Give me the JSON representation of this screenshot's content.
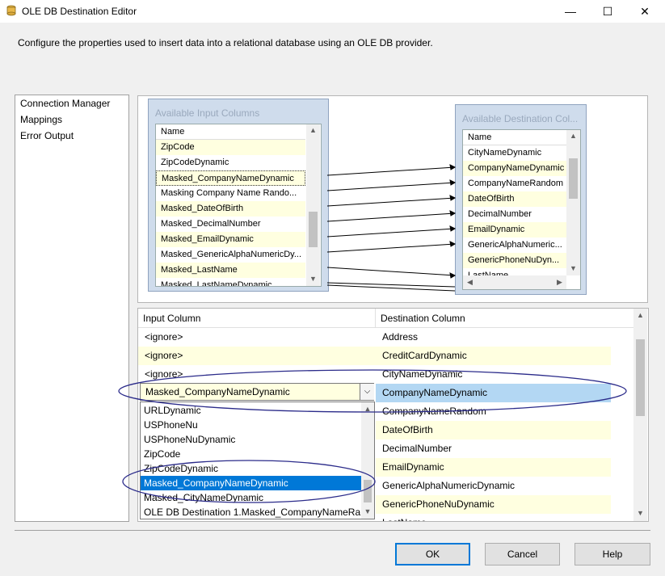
{
  "window": {
    "title": "OLE DB Destination Editor",
    "minimize_glyph": "—",
    "maximize_glyph": "☐",
    "close_glyph": "✕"
  },
  "description": "Configure the properties used to insert data into a relational database using an OLE DB provider.",
  "nav": {
    "items": [
      "Connection Manager",
      "Mappings",
      "Error Output"
    ]
  },
  "available_input": {
    "title": "Available Input Columns",
    "header": "Name",
    "rows": [
      "ZipCode",
      "ZipCodeDynamic",
      "Masked_CompanyNameDynamic",
      "Masking Company Name Rando...",
      "Masked_DateOfBirth",
      "Masked_DecimalNumber",
      "Masked_EmailDynamic",
      "Masked_GenericAlphaNumericDy...",
      "Masked_LastName",
      "Masked_LastNameDynamic"
    ]
  },
  "available_destination": {
    "title": "Available Destination Col...",
    "header": "Name",
    "rows": [
      "CityNameDynamic",
      "CompanyNameDynamic",
      "CompanyNameRandom",
      "DateOfBirth",
      "DecimalNumber",
      "EmailDynamic",
      "GenericAlphaNumeric...",
      "GenericPhoneNuDyn...",
      "LastName"
    ]
  },
  "grid": {
    "headers": {
      "input": "Input Column",
      "destination": "Destination Column"
    },
    "rows": [
      {
        "input": "<ignore>",
        "destination": "Address"
      },
      {
        "input": "<ignore>",
        "destination": "CreditCardDynamic"
      },
      {
        "input": "<ignore>",
        "destination": "CityNameDynamic"
      },
      {
        "input": "Masked_CompanyNameDynamic",
        "destination": "CompanyNameDynamic"
      },
      {
        "input": "",
        "destination": "CompanyNameRandom"
      },
      {
        "input": "",
        "destination": "DateOfBirth"
      },
      {
        "input": "",
        "destination": "DecimalNumber"
      },
      {
        "input": "",
        "destination": "EmailDynamic"
      },
      {
        "input": "",
        "destination": "GenericAlphaNumericDynamic"
      },
      {
        "input": "",
        "destination": "GenericPhoneNuDynamic"
      },
      {
        "input": "",
        "destination": "LastName"
      }
    ]
  },
  "combo": {
    "value": "Masked_CompanyNameDynamic",
    "options": [
      "URLDynamic",
      "USPhoneNu",
      "USPhoneNuDynamic",
      "ZipCode",
      "ZipCodeDynamic",
      "Masked_CompanyNameDynamic",
      "Masked_CityNameDynamic",
      "OLE DB Destination 1.Masked_CompanyNameRa..."
    ]
  },
  "buttons": {
    "ok": "OK",
    "cancel": "Cancel",
    "help": "Help"
  },
  "colors": {
    "highlight": "#0078d7",
    "row_yellow": "#ffffe0",
    "annotation": "#2b2b8a"
  }
}
